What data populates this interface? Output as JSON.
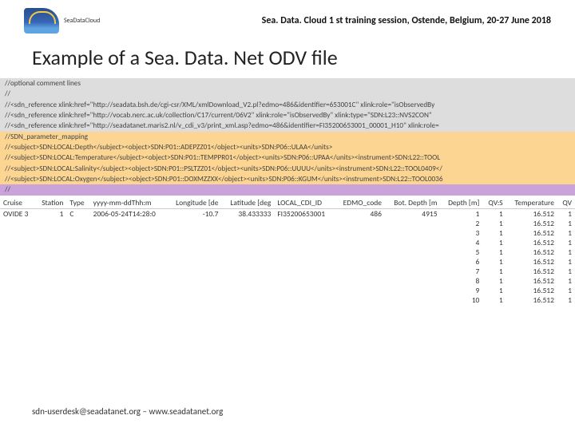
{
  "header": {
    "logo_text": "SeaDataCloud",
    "session": "Sea. Data. Cloud 1 st training session, Ostende, Belgium, 20-27 June 2018"
  },
  "title": "Example of a Sea. Data. Net ODV file",
  "code": {
    "gray_lines": [
      "//optional comment lines",
      "//",
      "//<sdn_reference xlink:href=\"http://seadata.bsh.de/cgi-csr/XML/xmlDownload_V2.pl?edmo=486&identifier=653001C\" xlink:role=\"isObservedBy",
      "//<sdn_reference xlink:href=\"http://vocab.nerc.ac.uk/collection/C17/current/06V2\" xlink:role=\"isObservedBy\" xlink:type=\"SDN:L23::NVS2CON\"",
      "//<sdn_reference xlink:href=\"http://seadatanet.maris2.nl/v_cdi_v3/print_xml.asp?edmo=486&identifier=FI35200653001_00001_H10\" xlink:role="
    ],
    "orange_lines": [
      "//SDN_parameter_mapping",
      "//<subject>SDN:LOCAL:Depth</subject><object>SDN:P01::ADEPZZ01</object><units>SDN:P06::ULAA</units>",
      "//<subject>SDN:LOCAL:Temperature</subject><object>SDN:P01::TEMPPR01</object><units>SDN:P06::UPAA</units><instrument>SDN:L22::TOOL",
      "//<subject>SDN:LOCAL:Salinity</subject><object>SDN:P01::PSLTZZ01</object><units>SDN:P06::UUUU</units><instrument>SDN:L22::TOOL0409</",
      "//<subject>SDN:LOCAL:Oxygen</subject><object>SDN:P01::DOXMZZXX</object><units>SDN:P06::KGUM</units><instrument>SDN:L22::TOOL0036"
    ],
    "purple_lines": [
      "//"
    ]
  },
  "table": {
    "headers": [
      "Cruise",
      "Station",
      "Type",
      "yyyy-mm-ddThh:m",
      "Longitude [de",
      "Latitude [deg",
      "LOCAL_CDI_ID",
      "EDMO_code",
      "Bot. Depth [m",
      "Depth [m]",
      "QV:S",
      "Temperature",
      "QV"
    ],
    "first_row": [
      "OVIDE 3",
      "1",
      "C",
      "2006-05-24T14:28:0",
      "-10.7",
      "38.433333",
      "FI35200653001",
      "486",
      "4915",
      "1",
      "1",
      "16.512",
      "1"
    ],
    "rows": [
      [
        "2",
        "1",
        "16.512",
        "1"
      ],
      [
        "3",
        "1",
        "16.512",
        "1"
      ],
      [
        "4",
        "1",
        "16.512",
        "1"
      ],
      [
        "5",
        "1",
        "16.512",
        "1"
      ],
      [
        "6",
        "1",
        "16.512",
        "1"
      ],
      [
        "7",
        "1",
        "16.512",
        "1"
      ],
      [
        "8",
        "1",
        "16.512",
        "1"
      ],
      [
        "9",
        "1",
        "16.512",
        "1"
      ],
      [
        "10",
        "1",
        "16.512",
        "1"
      ]
    ]
  },
  "footer": "sdn-userdesk@seadatanet.org – www.seadatanet.org"
}
